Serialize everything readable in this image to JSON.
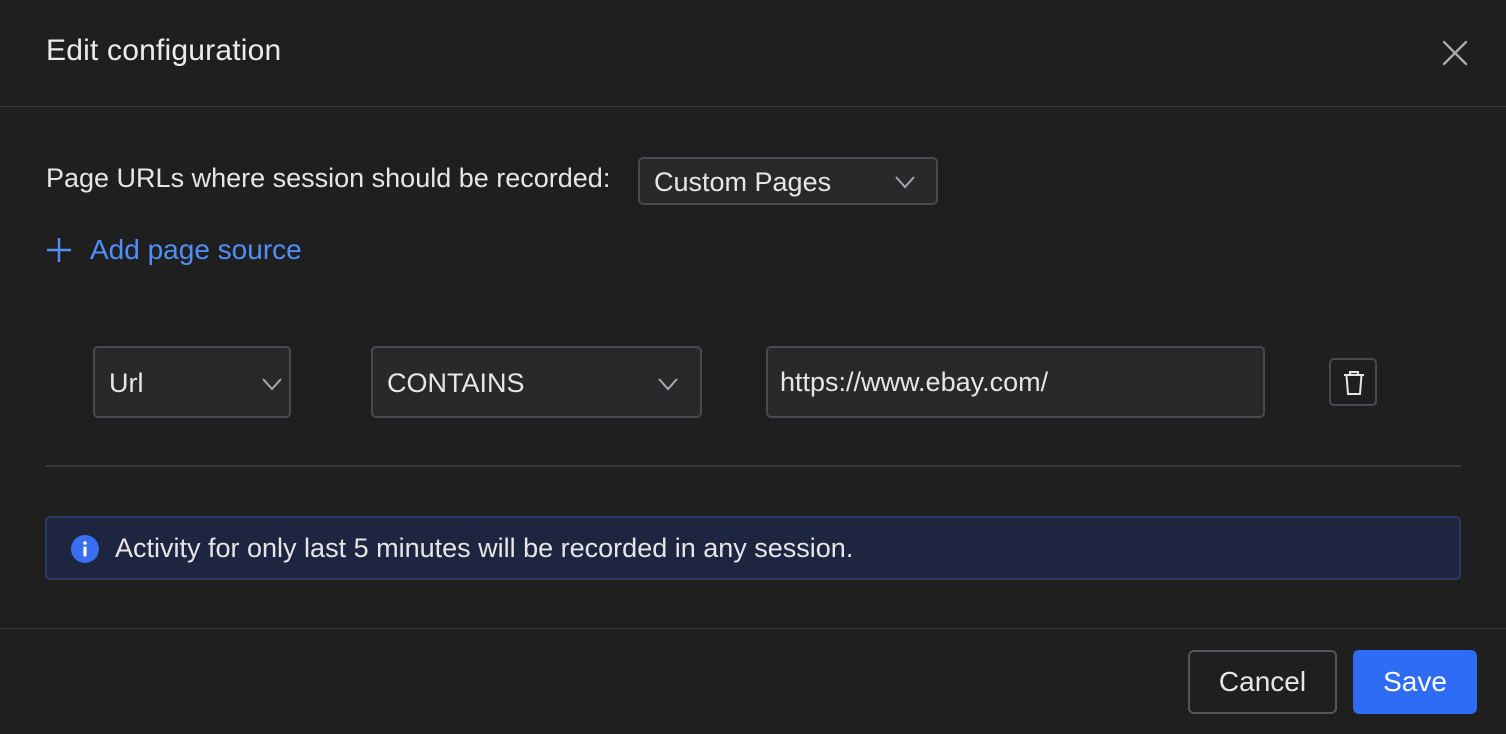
{
  "dialog": {
    "title": "Edit configuration",
    "close_icon": "close-icon"
  },
  "page_urls": {
    "label": "Page URLs where session should be recorded:",
    "selected": "Custom Pages"
  },
  "add_source": {
    "label": "Add page source",
    "icon": "plus-icon"
  },
  "rule": {
    "field": "Url",
    "operator": "CONTAINS",
    "value": "https://www.ebay.com/",
    "delete_icon": "trash-icon"
  },
  "info": {
    "text": "Activity for only last 5 minutes will be recorded in any session.",
    "icon": "info-icon"
  },
  "footer": {
    "cancel_label": "Cancel",
    "save_label": "Save"
  },
  "colors": {
    "background": "#1f1f20",
    "accent": "#2f6cf5",
    "link": "#4f8ff7",
    "info_bg": "#1d2541"
  }
}
